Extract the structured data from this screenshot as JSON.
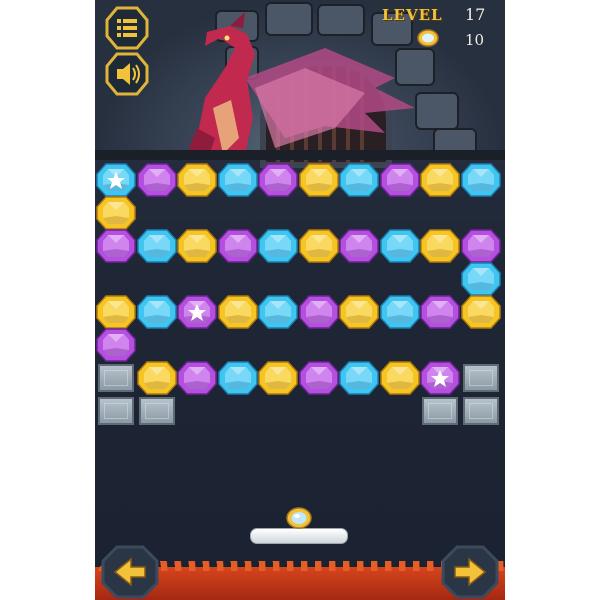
{
  "hud": {
    "level_label": "LEVEL",
    "level_value": "17",
    "coins_value": "10",
    "menu_icon": "menu-list-icon",
    "sound_icon": "speaker-icon",
    "coin_icon": "coin-icon"
  },
  "colors": {
    "cyan": "#3fc5f0",
    "purple": "#b44fe0",
    "gold": "#f5c526",
    "hud_gold": "#f2c23a",
    "lava": "#c7381a"
  },
  "bricks": {
    "rows": [
      [
        "cyan-star",
        "purple",
        "gold",
        "cyan",
        "purple",
        "gold",
        "cyan",
        "purple",
        "gold",
        "cyan"
      ],
      [
        "gold",
        "",
        "",
        "",
        "",
        "",
        "",
        "",
        "",
        ""
      ],
      [
        "purple",
        "cyan",
        "gold",
        "purple",
        "cyan",
        "gold",
        "purple",
        "cyan",
        "gold",
        "purple"
      ],
      [
        "",
        "",
        "",
        "",
        "",
        "",
        "",
        "",
        "",
        "cyan"
      ],
      [
        "gold",
        "cyan",
        "purple-star",
        "gold",
        "cyan",
        "purple",
        "gold",
        "cyan",
        "purple",
        "gold"
      ],
      [
        "purple",
        "",
        "",
        "",
        "",
        "",
        "",
        "",
        "",
        ""
      ],
      [
        "stone",
        "gold",
        "purple",
        "cyan",
        "gold",
        "purple",
        "cyan",
        "gold",
        "purple-star",
        "stone"
      ],
      [
        "stone",
        "stone",
        "",
        "",
        "",
        "",
        "",
        "",
        "stone",
        "stone"
      ]
    ]
  },
  "controls": {
    "left_icon": "arrow-left-icon",
    "right_icon": "arrow-right-icon"
  }
}
